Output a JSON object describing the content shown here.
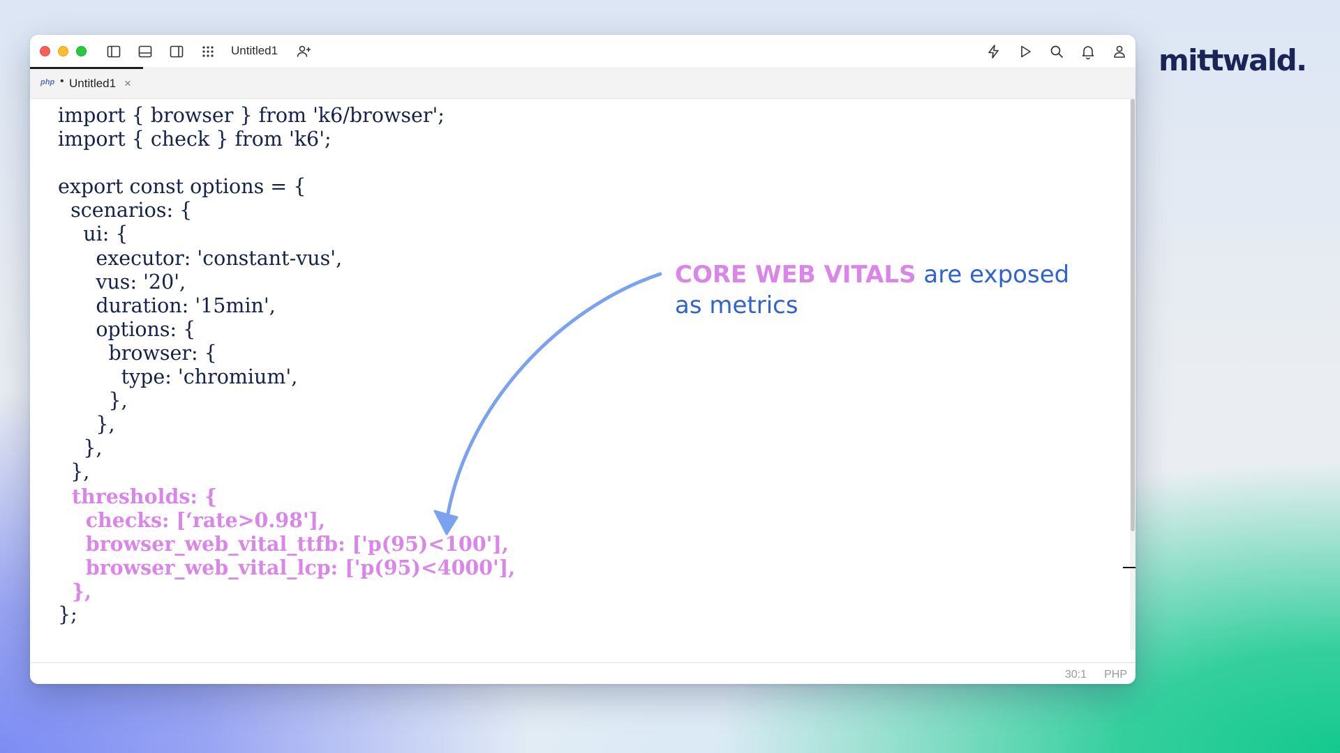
{
  "brand": {
    "logo_text": "mittwald."
  },
  "window": {
    "title": "Untitled1",
    "toolbar_icons": [
      "sidebar-left-icon",
      "panel-bottom-icon",
      "sidebar-right-icon",
      "apps-grid-icon",
      "add-user-icon",
      "lightning-icon",
      "play-icon",
      "search-icon",
      "bell-icon",
      "user-icon"
    ]
  },
  "tab": {
    "language": "php",
    "modified_marker": "•",
    "name": "Untitled1",
    "close_glyph": "×"
  },
  "code_lines": [
    "import { browser } from 'k6/browser';",
    "import { check } from 'k6';",
    "",
    "export const options = {",
    "  scenarios: {",
    "    ui: {",
    "      executor: 'constant-vus',",
    "      vus: '20',",
    "      duration: '15min',",
    "      options: {",
    "        browser: {",
    "          type: 'chromium',",
    "        },",
    "      },",
    "    },",
    "  },",
    "  thresholds: {",
    "    checks: [‘rate>0.98'],",
    "    browser_web_vital_ttfb: ['p(95)<100'],",
    "    browser_web_vital_lcp: ['p(95)<4000'],",
    "  },",
    "};"
  ],
  "highlighted_lines": [
    16,
    17,
    18,
    19,
    20
  ],
  "status": {
    "position": "30:1",
    "language": "PHP"
  },
  "annotation": {
    "strong": "CORE WEB VITALS",
    "rest_line1": " are exposed",
    "line2": "as metrics"
  },
  "colors": {
    "code_text": "#15224a",
    "highlight_pink": "#d986e8",
    "annotation_blue": "#2f63cf",
    "arrow_blue": "#7aa2ee",
    "brand_navy": "#1b2456"
  }
}
